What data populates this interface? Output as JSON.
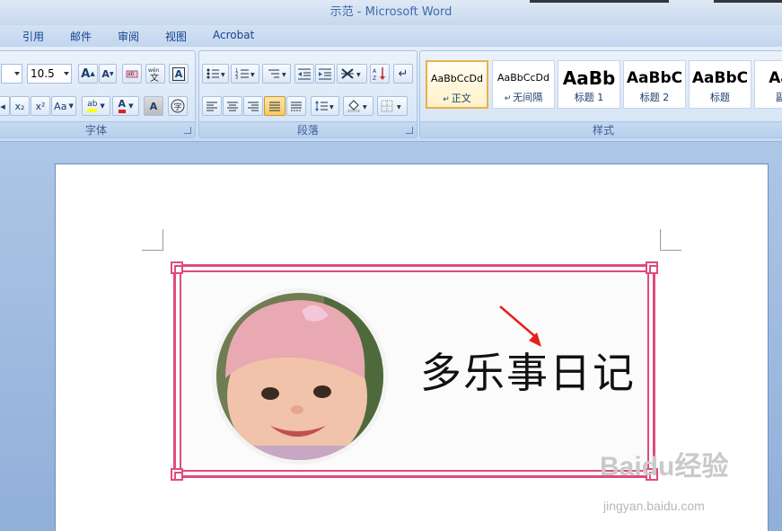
{
  "window": {
    "title": "示范 - Microsoft Word"
  },
  "tabs": [
    "引用",
    "邮件",
    "审阅",
    "视图",
    "Acrobat"
  ],
  "font_group": {
    "label": "字体",
    "size_value": "10.5",
    "grow_label": "A",
    "shrink_label": "A",
    "change_case_label": "Aa",
    "subscript_label": "x₂",
    "superscript_label": "x²",
    "highlight_label": "ab",
    "font_color_label": "A",
    "char_shade_label": "A",
    "clear_format_label": "A"
  },
  "paragraph_group": {
    "label": "段落"
  },
  "styles_group": {
    "label": "样式",
    "cards": [
      {
        "sample": "AaBbCcDd",
        "name": "正文"
      },
      {
        "sample": "AaBbCcDd",
        "name": "无间隔"
      },
      {
        "sample": "AaBb",
        "name": "标题 1"
      },
      {
        "sample": "AaBbC",
        "name": "标题 2"
      },
      {
        "sample": "AaBbC",
        "name": "标题"
      },
      {
        "sample": "AaB",
        "name": "副标"
      }
    ]
  },
  "document": {
    "headline": "多乐事日记"
  },
  "watermark": {
    "brand": "Baidu经验",
    "url": "jingyan.baidu.com"
  },
  "colors": {
    "frame": "#e04a80",
    "arrow": "#e8201a",
    "highlight": "#ffff00",
    "font_red": "#e02020"
  }
}
